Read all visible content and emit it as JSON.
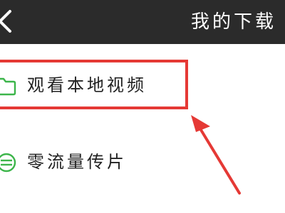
{
  "header": {
    "title": "我的下载",
    "back_icon": "chevron-left-icon"
  },
  "items": [
    {
      "label": "观看本地视频",
      "icon": "folder-icon"
    },
    {
      "label": "零流量传片",
      "icon": "transfer-icon"
    }
  ],
  "colors": {
    "header_bg": "#2b2b2b",
    "icon_green": "#3cb54a",
    "annotation_red": "#e53935"
  }
}
